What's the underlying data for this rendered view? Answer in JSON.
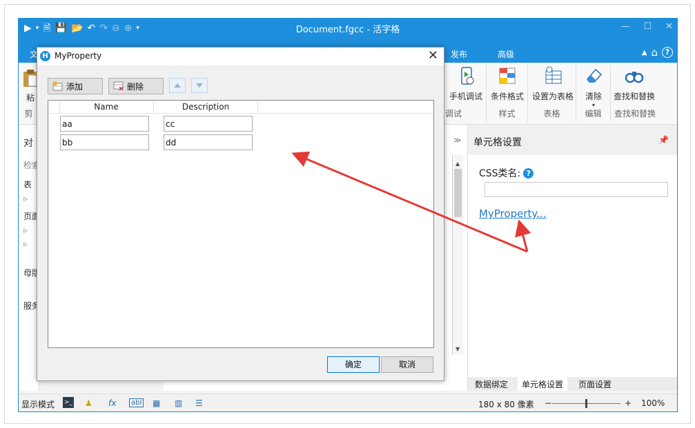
{
  "window": {
    "title": "Document.fgcc - 活字格",
    "controls": [
      "—",
      "☐",
      "✕"
    ]
  },
  "menu": {
    "file_tab": "文",
    "tabs": [
      "发布",
      "高级"
    ]
  },
  "ribbon": {
    "paste_label": "粘",
    "clipboard_group": "剪",
    "buttons": {
      "mobile_debug": "手机调试",
      "conditional_format": "条件格式",
      "set_as_table": "设置为表格",
      "clear": "清除",
      "find_replace": "查找和替换"
    },
    "groups": {
      "debug": "调试",
      "style": "样式",
      "table": "表格",
      "edit": "编辑",
      "find_replace": "查找和替换"
    }
  },
  "left_panel": {
    "title": "对",
    "search": "检索",
    "items": [
      "表",
      "页面",
      "母版",
      "服务"
    ]
  },
  "right_panel": {
    "title": "单元格设置",
    "css_label": "CSS类名:",
    "css_value": "",
    "myproperty_link": "MyProperty...",
    "tabs": [
      "数据绑定",
      "单元格设置",
      "页面设置"
    ]
  },
  "statusbar": {
    "display_mode": "显示模式",
    "dimensions": "180 x 80 像素",
    "zoom": "100%",
    "zoom_level": 0.5
  },
  "dialog": {
    "title": "MyProperty",
    "add_button": "添加",
    "delete_button": "删除",
    "columns": [
      "Name",
      "Description"
    ],
    "rows": [
      {
        "name": "aa",
        "description": "cc"
      },
      {
        "name": "bb",
        "description": "dd"
      }
    ],
    "ok_button": "确定",
    "cancel_button": "取消"
  },
  "colors": {
    "title_blue": "#1e8fdc",
    "annotation_red": "#e53935",
    "link_blue": "#1e7ac6"
  }
}
